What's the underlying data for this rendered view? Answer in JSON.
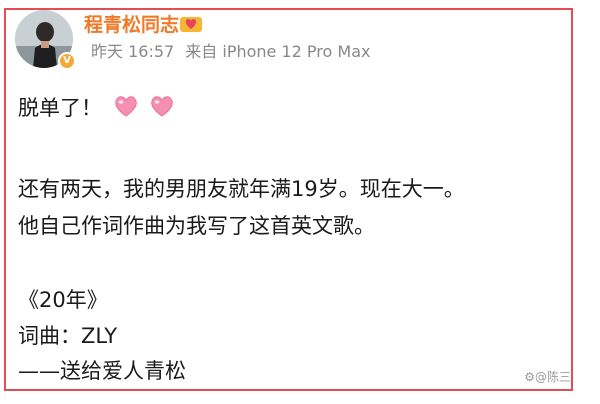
{
  "post": {
    "author": {
      "name": "程青松同志",
      "verified_badge": "V",
      "avatar_icon": "avatar-photo",
      "name_badge_icon": "heart-badge-icon"
    },
    "meta": {
      "time": "昨天 16:57",
      "source": "来自 iPhone 12 Pro Max"
    },
    "content": {
      "line1": "脱单了！",
      "line1_icons": [
        "pink-heart-icon",
        "pink-heart-icon"
      ],
      "line2": "还有两天，我的男朋友就年满19岁。现在大一。",
      "line3": "他自己作词作曲为我写了这首英文歌。",
      "line4": "《20年》",
      "line5": "词曲：ZLY",
      "line6": "——送给爱人青松"
    }
  },
  "watermark": {
    "text": "⚙@陈三"
  },
  "colors": {
    "frame_border": "#e24c54",
    "username": "#f07a28",
    "meta": "#888888",
    "body_text": "#1a1a1a",
    "heart": "#f48fb1",
    "verified_badge": "#f3a93a"
  }
}
